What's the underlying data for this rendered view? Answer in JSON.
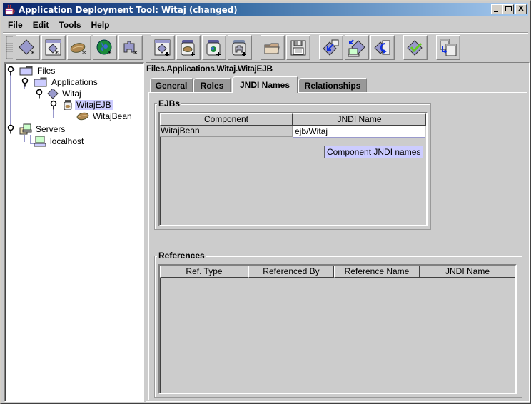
{
  "window": {
    "title": "Application Deployment Tool: Witaj (changed)",
    "controls": {
      "minimize": "_",
      "maximize": "□",
      "close": "X"
    }
  },
  "menubar": {
    "items": [
      {
        "label": "File",
        "mnemonic": "F",
        "rest": "ile"
      },
      {
        "label": "Edit",
        "mnemonic": "E",
        "rest": "dit"
      },
      {
        "label": "Tools",
        "mnemonic": "T",
        "rest": "ools"
      },
      {
        "label": "Help",
        "mnemonic": "H",
        "rest": "elp"
      }
    ]
  },
  "toolbar": {
    "buttons": [
      {
        "name": "new-application",
        "icon": "diamond-new-icon"
      },
      {
        "name": "new-application-client",
        "icon": "window-diamond-new-icon"
      },
      {
        "name": "new-enterprise-bean",
        "icon": "bean-new-icon"
      },
      {
        "name": "new-web-component",
        "icon": "globe-new-icon"
      },
      {
        "name": "new-connector",
        "icon": "puzzle-new-icon"
      },
      {
        "name": "add-application-client",
        "icon": "window-diamond-add-icon"
      },
      {
        "name": "add-enterprise-bean",
        "icon": "jar-bean-add-icon"
      },
      {
        "name": "add-web-component",
        "icon": "jar-globe-add-icon"
      },
      {
        "name": "add-connector",
        "icon": "jar-puzzle-add-icon"
      },
      {
        "name": "open",
        "icon": "folder-open-icon"
      },
      {
        "name": "save",
        "icon": "floppy-disk-icon"
      },
      {
        "name": "update-application-files",
        "icon": "diamond-update-icon"
      },
      {
        "name": "deploy",
        "icon": "deploy-computer-icon"
      },
      {
        "name": "update-and-redeploy",
        "icon": "redeploy-icon"
      },
      {
        "name": "verify",
        "icon": "diamond-check-icon"
      },
      {
        "name": "descriptor-viewer",
        "icon": "window-stack-icon"
      }
    ]
  },
  "tree": {
    "nodes": [
      {
        "label": "Files",
        "icon": "folder-icon",
        "expanded": true,
        "selected": false
      },
      {
        "label": "Applications",
        "icon": "folder-icon",
        "expanded": true,
        "selected": false
      },
      {
        "label": "Witaj",
        "icon": "diamond-icon",
        "expanded": true,
        "selected": false
      },
      {
        "label": "WitajEJB",
        "icon": "jar-icon",
        "expanded": true,
        "selected": true
      },
      {
        "label": "WitajBean",
        "icon": "bean-icon",
        "expanded": false,
        "selected": false
      },
      {
        "label": "Servers",
        "icon": "servers-icon",
        "expanded": true,
        "selected": false
      },
      {
        "label": "localhost",
        "icon": "computer-icon",
        "expanded": false,
        "selected": false
      }
    ]
  },
  "main": {
    "breadcrumb": "Files.Applications.Witaj.WitajEJB",
    "tabs": [
      {
        "label": "General",
        "active": false
      },
      {
        "label": "Roles",
        "active": false
      },
      {
        "label": "JNDI Names",
        "active": true
      },
      {
        "label": "Relationships",
        "active": false
      }
    ],
    "ejbs": {
      "title": "EJBs",
      "columns": [
        "Component",
        "JNDI Name"
      ],
      "rows": [
        {
          "component": "WitajBean",
          "jndi_name": "ejb/Witaj"
        }
      ],
      "tooltip": "Component JNDI names"
    },
    "references": {
      "title": "References",
      "columns": [
        "Ref. Type",
        "Referenced By",
        "Reference Name",
        "JNDI Name"
      ],
      "rows": []
    }
  }
}
